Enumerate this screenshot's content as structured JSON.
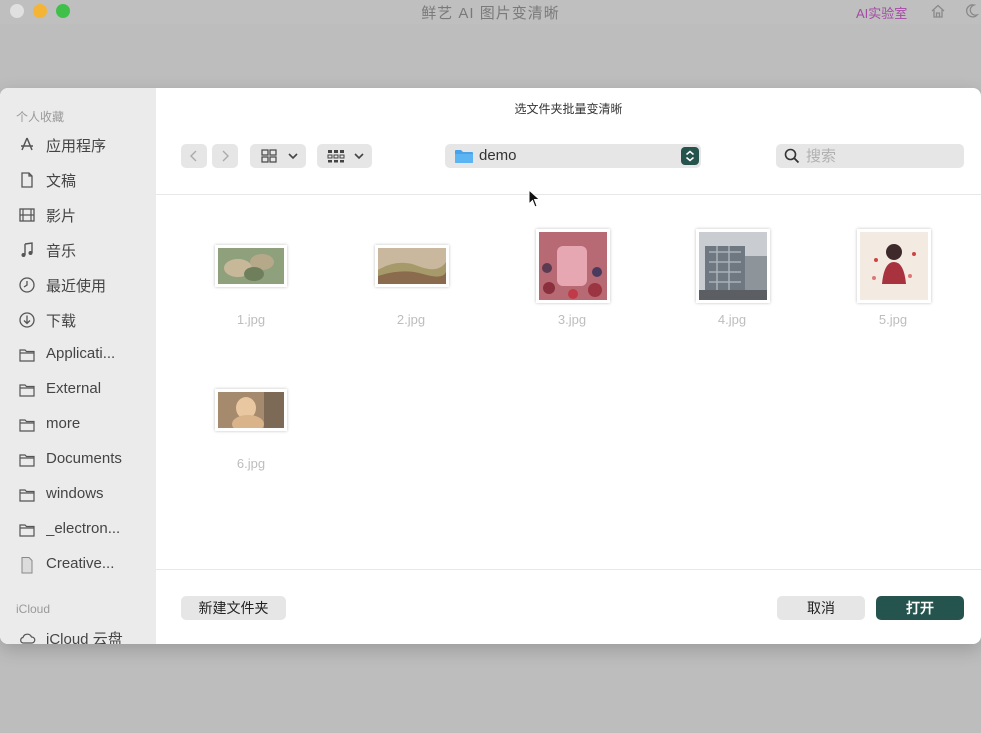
{
  "app": {
    "title": "鲜艺 AI 图片变清晰",
    "ai_lab_label": "AI实验室"
  },
  "dialog": {
    "title": "选文件夹批量变清晰",
    "path_label": "demo",
    "search": {
      "placeholder": "搜索",
      "value": ""
    },
    "new_folder_label": "新建文件夹",
    "cancel_label": "取消",
    "open_label": "打开"
  },
  "sidebar": {
    "favorites_header": "个人收藏",
    "icloud_header": "iCloud",
    "items": [
      {
        "label": "应用程序",
        "icon": "applications-icon"
      },
      {
        "label": "文稿",
        "icon": "document-icon"
      },
      {
        "label": "影片",
        "icon": "film-icon"
      },
      {
        "label": "音乐",
        "icon": "music-icon"
      },
      {
        "label": "最近使用",
        "icon": "clock-icon"
      },
      {
        "label": "下载",
        "icon": "download-icon"
      },
      {
        "label": "Applicati...",
        "icon": "folder-icon"
      },
      {
        "label": "External",
        "icon": "folder-icon"
      },
      {
        "label": "more",
        "icon": "folder-icon"
      },
      {
        "label": "Documents",
        "icon": "folder-icon"
      },
      {
        "label": "windows",
        "icon": "folder-icon"
      },
      {
        "label": "_electron...",
        "icon": "folder-icon"
      },
      {
        "label": "Creative...",
        "icon": "file-icon"
      }
    ],
    "icloud_items": [
      {
        "label": "iCloud 云盘",
        "icon": "cloud-icon"
      }
    ]
  },
  "files": [
    {
      "name": "1.jpg"
    },
    {
      "name": "2.jpg"
    },
    {
      "name": "3.jpg"
    },
    {
      "name": "4.jpg"
    },
    {
      "name": "5.jpg"
    },
    {
      "name": "6.jpg"
    }
  ],
  "colors": {
    "accent": "#25544e",
    "ai_lab": "#a64aa6",
    "traffic_yellow": "#f4b536",
    "traffic_green": "#3fc04a"
  }
}
